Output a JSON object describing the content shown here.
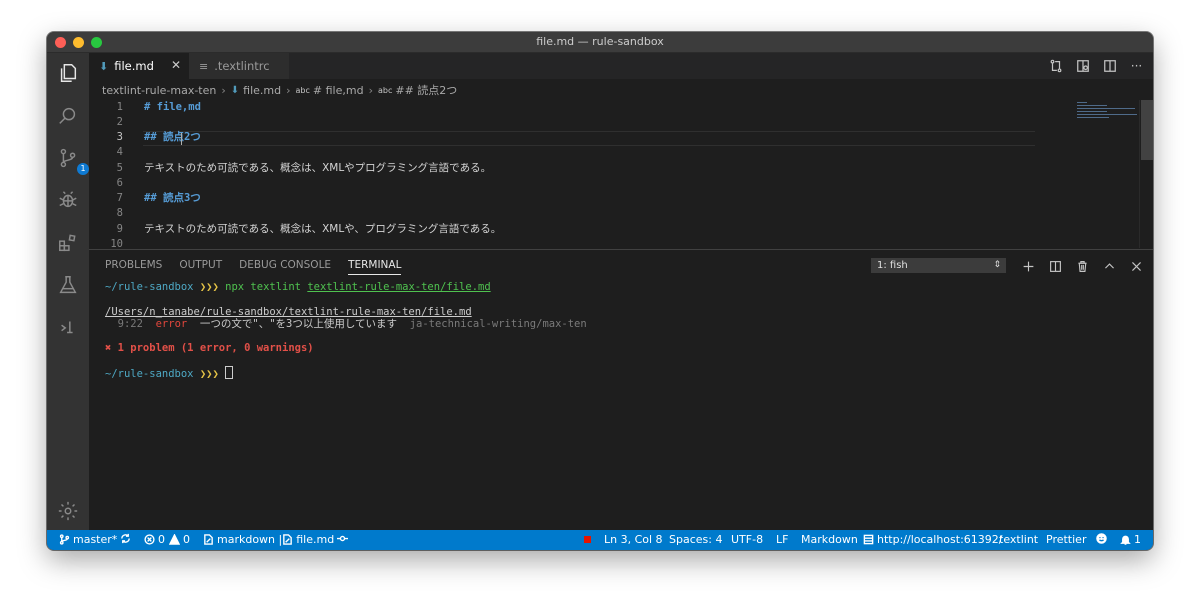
{
  "window": {
    "title": "file.md — rule-sandbox"
  },
  "activity_bar": {
    "items": [
      {
        "icon": "files-icon"
      },
      {
        "icon": "search-icon"
      },
      {
        "icon": "source-control-icon",
        "badge": "1"
      },
      {
        "icon": "debug-icon"
      },
      {
        "icon": "extensions-icon"
      },
      {
        "icon": "flask-icon"
      },
      {
        "icon": "remote-icon"
      },
      {
        "icon": "settings-gear-icon"
      }
    ]
  },
  "tabs": [
    {
      "label": "file.md",
      "active": true,
      "icon": "markdown-icon"
    },
    {
      "label": ".textlintrc",
      "active": false,
      "icon": "lines-icon"
    }
  ],
  "breadcrumb": {
    "folder": "textlint-rule-max-ten",
    "file": "file.md",
    "symbol1_prefix": "abc",
    "symbol1": "# file,md",
    "symbol2_prefix": "abc",
    "symbol2": "## 読点2つ"
  },
  "editor": {
    "current_line": 3,
    "lines": [
      {
        "num": "1",
        "text": "# file,md",
        "heading": true
      },
      {
        "num": "2",
        "text": ""
      },
      {
        "num": "3",
        "text": "## 読点2つ",
        "heading": true
      },
      {
        "num": "4",
        "text": ""
      },
      {
        "num": "5",
        "text": "テキストのため可読である、概念は、XMLやプログラミング言語である。"
      },
      {
        "num": "6",
        "text": ""
      },
      {
        "num": "7",
        "text": "## 読点3つ",
        "heading": true
      },
      {
        "num": "8",
        "text": ""
      },
      {
        "num": "9",
        "text": "テキストのため可読である、概念は、XMLや、プログラミング言語である。"
      },
      {
        "num": "10",
        "text": ""
      }
    ]
  },
  "panel": {
    "tabs": [
      "PROBLEMS",
      "OUTPUT",
      "DEBUG CONSOLE",
      "TERMINAL"
    ],
    "active_tab": "TERMINAL",
    "terminal_select": "1: fish",
    "terminal": {
      "prompt_dir": "~/rule-sandbox",
      "prompt_arrows": "❯❯❯",
      "cmd": "npx textlint",
      "cmd_arg": "textlint-rule-max-ten/file.md",
      "result_path": "/Users/n_tanabe/rule-sandbox/textlint-rule-max-ten/file.md",
      "err_pos": "9:22",
      "err_level": "error",
      "err_msg": "一つの文で\"、\"を3つ以上使用しています",
      "err_rule": "ja-technical-writing/max-ten",
      "summary": "✖ 1 problem (1 error, 0 warnings)",
      "prompt2_dir": "~/rule-sandbox"
    }
  },
  "status_bar": {
    "branch": "master*",
    "errors": "0",
    "warnings": "0",
    "lang_mode_item": "markdown | ",
    "file_item": "file.md",
    "position": "Ln 3, Col 8",
    "spaces": "Spaces: 4",
    "encoding": "UTF-8",
    "eol": "LF",
    "language": "Markdown",
    "server": "http://localhost:61392/",
    "textlint": "textlint",
    "prettier": "Prettier",
    "notifications": "1",
    "colors": {
      "background": "#007acc",
      "error_square": "#e51400"
    }
  }
}
